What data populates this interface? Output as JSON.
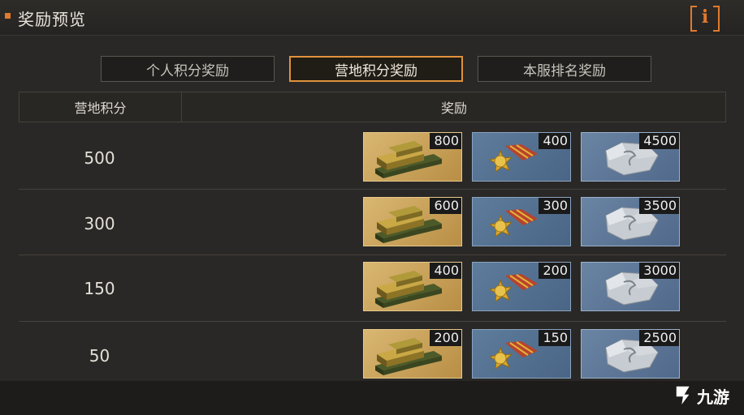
{
  "header": {
    "title": "奖励预览",
    "info_label": "i"
  },
  "tabs": [
    {
      "label": "个人积分奖励",
      "active": false
    },
    {
      "label": "营地积分奖励",
      "active": true
    },
    {
      "label": "本服排名奖励",
      "active": false
    }
  ],
  "table": {
    "headers": {
      "score": "营地积分",
      "reward": "奖励"
    },
    "rows": [
      {
        "score": "500",
        "gold": "800",
        "medal": "400",
        "stone": "4500"
      },
      {
        "score": "300",
        "gold": "600",
        "medal": "300",
        "stone": "3500"
      },
      {
        "score": "150",
        "gold": "400",
        "medal": "200",
        "stone": "3000"
      },
      {
        "score": "50",
        "gold": "200",
        "medal": "150",
        "stone": "2500"
      }
    ]
  },
  "watermark": {
    "text": "九游"
  },
  "colors": {
    "accent": "#e07a2e",
    "tab_active_border": "#e0923a"
  }
}
